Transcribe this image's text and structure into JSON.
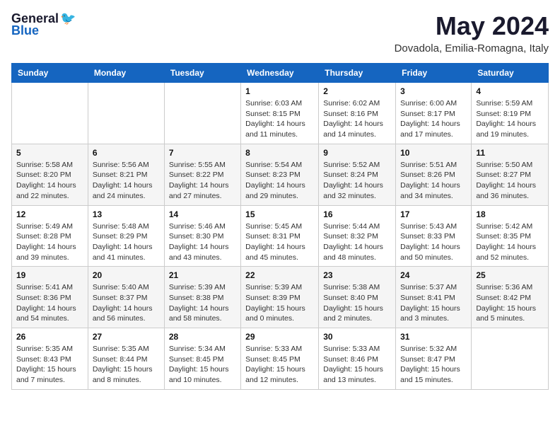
{
  "header": {
    "logo_general": "General",
    "logo_blue": "Blue",
    "month_year": "May 2024",
    "location": "Dovadola, Emilia-Romagna, Italy"
  },
  "weekdays": [
    "Sunday",
    "Monday",
    "Tuesday",
    "Wednesday",
    "Thursday",
    "Friday",
    "Saturday"
  ],
  "weeks": [
    [
      {
        "day": "",
        "sunrise": "",
        "sunset": "",
        "daylight": ""
      },
      {
        "day": "",
        "sunrise": "",
        "sunset": "",
        "daylight": ""
      },
      {
        "day": "",
        "sunrise": "",
        "sunset": "",
        "daylight": ""
      },
      {
        "day": "1",
        "sunrise": "Sunrise: 6:03 AM",
        "sunset": "Sunset: 8:15 PM",
        "daylight": "Daylight: 14 hours and 11 minutes."
      },
      {
        "day": "2",
        "sunrise": "Sunrise: 6:02 AM",
        "sunset": "Sunset: 8:16 PM",
        "daylight": "Daylight: 14 hours and 14 minutes."
      },
      {
        "day": "3",
        "sunrise": "Sunrise: 6:00 AM",
        "sunset": "Sunset: 8:17 PM",
        "daylight": "Daylight: 14 hours and 17 minutes."
      },
      {
        "day": "4",
        "sunrise": "Sunrise: 5:59 AM",
        "sunset": "Sunset: 8:19 PM",
        "daylight": "Daylight: 14 hours and 19 minutes."
      }
    ],
    [
      {
        "day": "5",
        "sunrise": "Sunrise: 5:58 AM",
        "sunset": "Sunset: 8:20 PM",
        "daylight": "Daylight: 14 hours and 22 minutes."
      },
      {
        "day": "6",
        "sunrise": "Sunrise: 5:56 AM",
        "sunset": "Sunset: 8:21 PM",
        "daylight": "Daylight: 14 hours and 24 minutes."
      },
      {
        "day": "7",
        "sunrise": "Sunrise: 5:55 AM",
        "sunset": "Sunset: 8:22 PM",
        "daylight": "Daylight: 14 hours and 27 minutes."
      },
      {
        "day": "8",
        "sunrise": "Sunrise: 5:54 AM",
        "sunset": "Sunset: 8:23 PM",
        "daylight": "Daylight: 14 hours and 29 minutes."
      },
      {
        "day": "9",
        "sunrise": "Sunrise: 5:52 AM",
        "sunset": "Sunset: 8:24 PM",
        "daylight": "Daylight: 14 hours and 32 minutes."
      },
      {
        "day": "10",
        "sunrise": "Sunrise: 5:51 AM",
        "sunset": "Sunset: 8:26 PM",
        "daylight": "Daylight: 14 hours and 34 minutes."
      },
      {
        "day": "11",
        "sunrise": "Sunrise: 5:50 AM",
        "sunset": "Sunset: 8:27 PM",
        "daylight": "Daylight: 14 hours and 36 minutes."
      }
    ],
    [
      {
        "day": "12",
        "sunrise": "Sunrise: 5:49 AM",
        "sunset": "Sunset: 8:28 PM",
        "daylight": "Daylight: 14 hours and 39 minutes."
      },
      {
        "day": "13",
        "sunrise": "Sunrise: 5:48 AM",
        "sunset": "Sunset: 8:29 PM",
        "daylight": "Daylight: 14 hours and 41 minutes."
      },
      {
        "day": "14",
        "sunrise": "Sunrise: 5:46 AM",
        "sunset": "Sunset: 8:30 PM",
        "daylight": "Daylight: 14 hours and 43 minutes."
      },
      {
        "day": "15",
        "sunrise": "Sunrise: 5:45 AM",
        "sunset": "Sunset: 8:31 PM",
        "daylight": "Daylight: 14 hours and 45 minutes."
      },
      {
        "day": "16",
        "sunrise": "Sunrise: 5:44 AM",
        "sunset": "Sunset: 8:32 PM",
        "daylight": "Daylight: 14 hours and 48 minutes."
      },
      {
        "day": "17",
        "sunrise": "Sunrise: 5:43 AM",
        "sunset": "Sunset: 8:33 PM",
        "daylight": "Daylight: 14 hours and 50 minutes."
      },
      {
        "day": "18",
        "sunrise": "Sunrise: 5:42 AM",
        "sunset": "Sunset: 8:35 PM",
        "daylight": "Daylight: 14 hours and 52 minutes."
      }
    ],
    [
      {
        "day": "19",
        "sunrise": "Sunrise: 5:41 AM",
        "sunset": "Sunset: 8:36 PM",
        "daylight": "Daylight: 14 hours and 54 minutes."
      },
      {
        "day": "20",
        "sunrise": "Sunrise: 5:40 AM",
        "sunset": "Sunset: 8:37 PM",
        "daylight": "Daylight: 14 hours and 56 minutes."
      },
      {
        "day": "21",
        "sunrise": "Sunrise: 5:39 AM",
        "sunset": "Sunset: 8:38 PM",
        "daylight": "Daylight: 14 hours and 58 minutes."
      },
      {
        "day": "22",
        "sunrise": "Sunrise: 5:39 AM",
        "sunset": "Sunset: 8:39 PM",
        "daylight": "Daylight: 15 hours and 0 minutes."
      },
      {
        "day": "23",
        "sunrise": "Sunrise: 5:38 AM",
        "sunset": "Sunset: 8:40 PM",
        "daylight": "Daylight: 15 hours and 2 minutes."
      },
      {
        "day": "24",
        "sunrise": "Sunrise: 5:37 AM",
        "sunset": "Sunset: 8:41 PM",
        "daylight": "Daylight: 15 hours and 3 minutes."
      },
      {
        "day": "25",
        "sunrise": "Sunrise: 5:36 AM",
        "sunset": "Sunset: 8:42 PM",
        "daylight": "Daylight: 15 hours and 5 minutes."
      }
    ],
    [
      {
        "day": "26",
        "sunrise": "Sunrise: 5:35 AM",
        "sunset": "Sunset: 8:43 PM",
        "daylight": "Daylight: 15 hours and 7 minutes."
      },
      {
        "day": "27",
        "sunrise": "Sunrise: 5:35 AM",
        "sunset": "Sunset: 8:44 PM",
        "daylight": "Daylight: 15 hours and 8 minutes."
      },
      {
        "day": "28",
        "sunrise": "Sunrise: 5:34 AM",
        "sunset": "Sunset: 8:45 PM",
        "daylight": "Daylight: 15 hours and 10 minutes."
      },
      {
        "day": "29",
        "sunrise": "Sunrise: 5:33 AM",
        "sunset": "Sunset: 8:45 PM",
        "daylight": "Daylight: 15 hours and 12 minutes."
      },
      {
        "day": "30",
        "sunrise": "Sunrise: 5:33 AM",
        "sunset": "Sunset: 8:46 PM",
        "daylight": "Daylight: 15 hours and 13 minutes."
      },
      {
        "day": "31",
        "sunrise": "Sunrise: 5:32 AM",
        "sunset": "Sunset: 8:47 PM",
        "daylight": "Daylight: 15 hours and 15 minutes."
      },
      {
        "day": "",
        "sunrise": "",
        "sunset": "",
        "daylight": ""
      }
    ]
  ]
}
